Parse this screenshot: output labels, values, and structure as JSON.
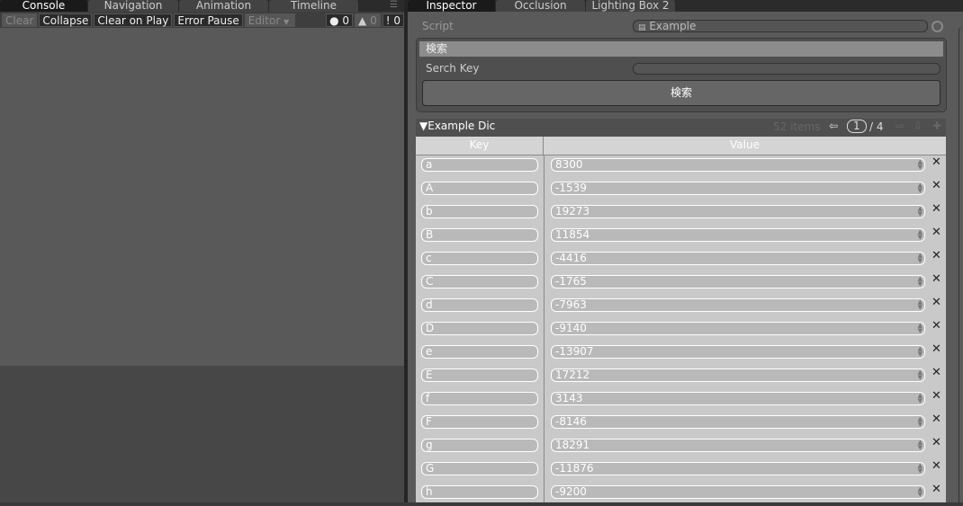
{
  "left_tabs": [
    "Console",
    "Navigation",
    "Animation",
    "Timeline"
  ],
  "toolbar": {
    "clear": "Clear",
    "collapse": "Collapse",
    "clear_on_play": "Clear on Play",
    "error_pause": "Error Pause",
    "editor": "Editor",
    "errors": "0",
    "warnings": "0",
    "logs": "0"
  },
  "right_tabs": [
    "Inspector",
    "Occlusion",
    "Lighting Box 2"
  ],
  "script": {
    "label": "Script",
    "value": "Example"
  },
  "search": {
    "header": "検索",
    "key_label": "Serch Key",
    "key_value": "",
    "button": "検索"
  },
  "dict": {
    "title": "Example Dic",
    "items": "52 items",
    "page": "1",
    "pages": "/ 4",
    "key_header": "Key",
    "value_header": "Value",
    "rows": [
      [
        "a",
        "8300"
      ],
      [
        "A",
        "-1539"
      ],
      [
        "b",
        "19273"
      ],
      [
        "B",
        "11854"
      ],
      [
        "c",
        "-4416"
      ],
      [
        "C",
        "-1765"
      ],
      [
        "d",
        "-7963"
      ],
      [
        "D",
        "-9140"
      ],
      [
        "e",
        "-13907"
      ],
      [
        "E",
        "17212"
      ],
      [
        "f",
        "3143"
      ],
      [
        "F",
        "-8146"
      ],
      [
        "g",
        "18291"
      ],
      [
        "G",
        "-11876"
      ],
      [
        "h",
        "-9200"
      ]
    ]
  }
}
